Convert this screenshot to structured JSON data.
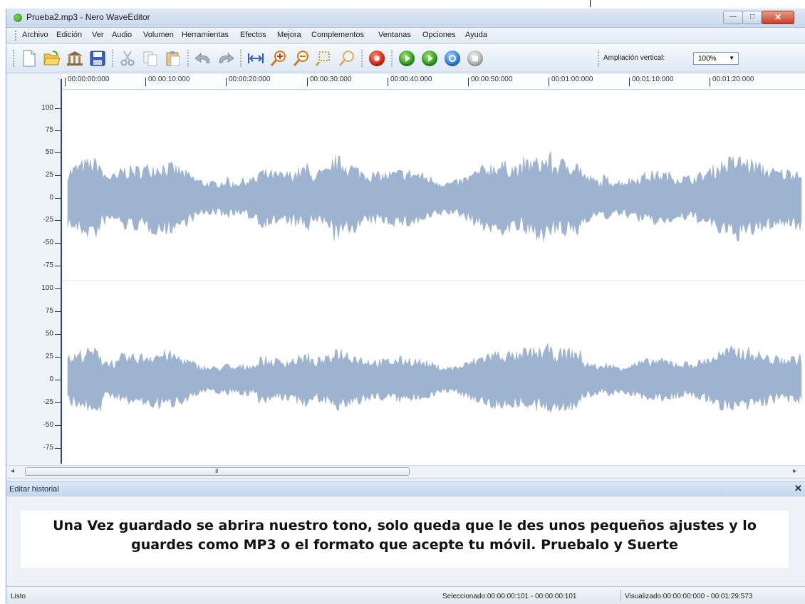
{
  "window": {
    "title": "Prueba2.mp3 - Nero WaveEditor",
    "controls": {
      "minimize": "—",
      "maximize": "□",
      "close": "✕"
    }
  },
  "menu": [
    "Archivo",
    "Edición",
    "Ver",
    "Audio",
    "Volumen",
    "Herramientas",
    "Efectos",
    "Mejora",
    "Complementos",
    "Ventanas",
    "Opciones",
    "Ayuda"
  ],
  "toolbar": {
    "icons": [
      "new-file-icon",
      "open-folder-icon",
      "library-icon",
      "save-icon",
      "cut-icon",
      "copy-icon",
      "paste-icon",
      "undo-icon",
      "redo-icon",
      "fit-width-icon",
      "zoom-in-icon",
      "zoom-out-icon",
      "zoom-selection-icon",
      "zoom-full-icon",
      "record-icon",
      "play-icon",
      "play-selection-icon",
      "loop-icon",
      "stop-icon"
    ],
    "zoom_label": "Ampliación vertical:",
    "zoom_value": "100%",
    "zoom_arrow": "▼"
  },
  "time_ruler": [
    "00:00:00:000",
    "00:00:10:000",
    "00:00:20:000",
    "00:00:30:000",
    "00:00:40:000",
    "00:00:50:000",
    "00:01:00:000",
    "00:01:10:000",
    "00:01:20:000"
  ],
  "channel1_axis": [
    "100",
    "75",
    "50",
    "25",
    "0",
    "-25",
    "-50",
    "-75"
  ],
  "channel2_axis": [
    "100",
    "75",
    "50",
    "25",
    "0",
    "-25",
    "-50",
    "-75"
  ],
  "waveform": {
    "color": "#9db3d0",
    "background": "#ffffff"
  },
  "scrollbar": {
    "left_arrow": "◂",
    "right_arrow": "▸",
    "grip": "III"
  },
  "history": {
    "title": "Editar historial",
    "close": "✕",
    "message": "Una Vez guardado se abrira nuestro tono, solo queda que le des unos pequeños ajustes y lo guardes como MP3 o el formato que acepte tu móvil. Pruebalo y Suerte"
  },
  "status": {
    "ready": "Listo",
    "selected": "Seleccionado:00:00:00:101 - 00:00:00:101",
    "visualized": "Visualizado:00:00:00:000 - 00:01:29:573"
  }
}
